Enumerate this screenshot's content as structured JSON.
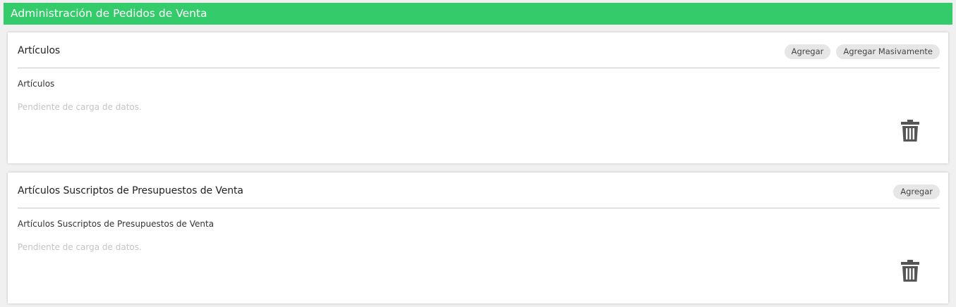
{
  "header": {
    "title": "Administración de Pedidos de Venta",
    "bg_color": "#34cb6a"
  },
  "panels": [
    {
      "title": "Artículos",
      "actions": [
        "Agregar",
        "Agregar Masivamente"
      ],
      "section_label": "Artículos",
      "empty_text": "Pendiente de carga de datos.",
      "delete_icon": "trash-icon"
    },
    {
      "title": "Artículos Suscriptos de Presupuestos de Venta",
      "actions": [
        "Agregar"
      ],
      "section_label": "Artículos Suscriptos de Presupuestos de Venta",
      "empty_text": "Pendiente de carga de datos.",
      "delete_icon": "trash-icon"
    }
  ]
}
